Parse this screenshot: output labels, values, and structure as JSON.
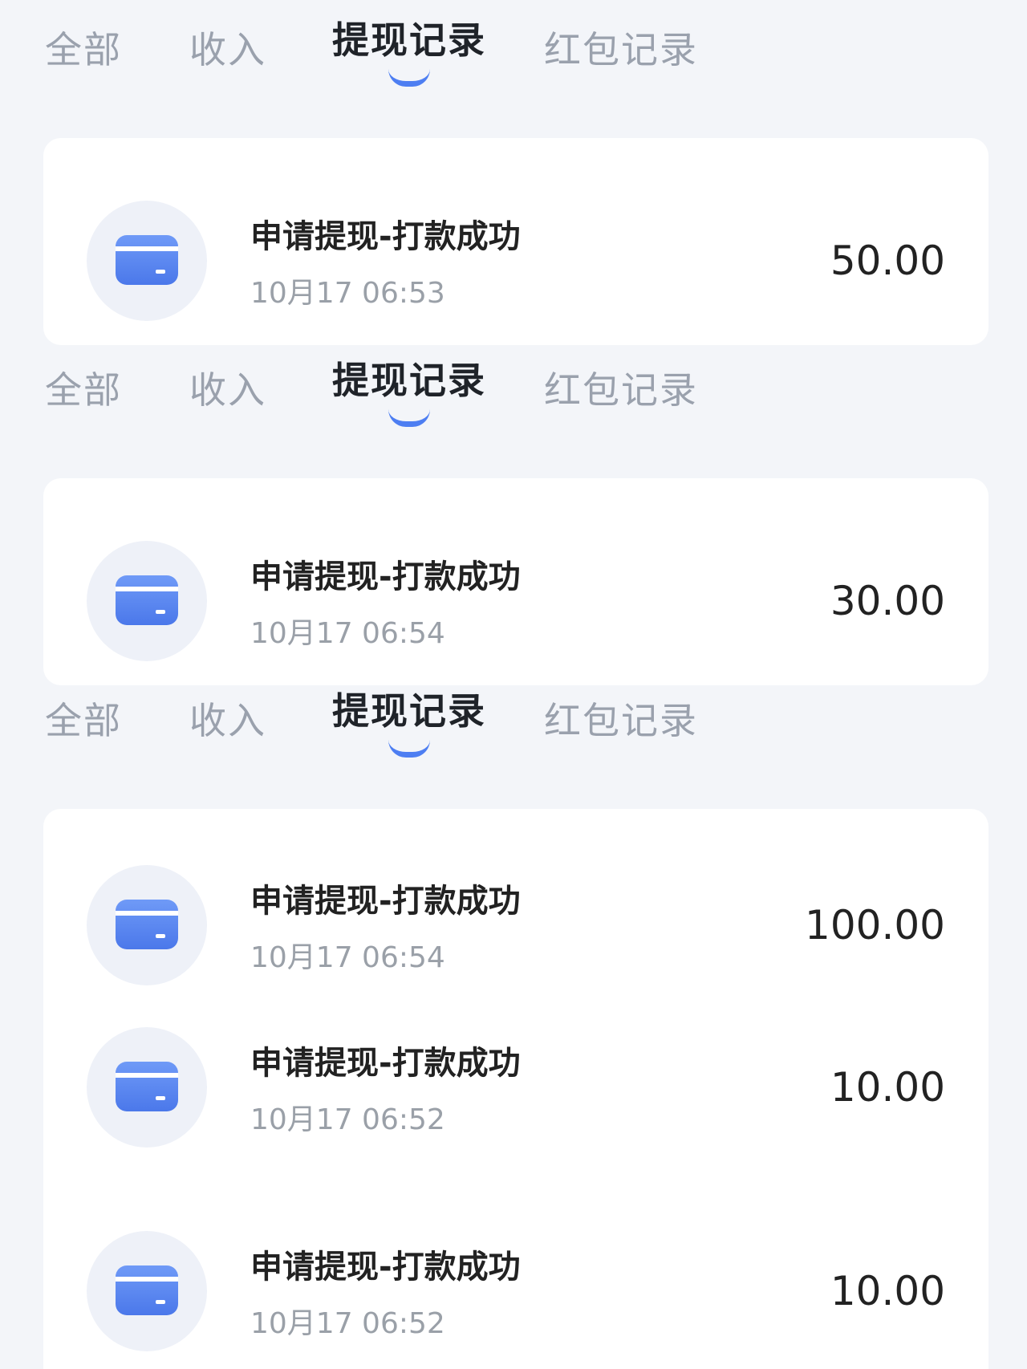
{
  "tabs": [
    "全部",
    "收入",
    "提现记录",
    "红包记录"
  ],
  "active_tab": "提现记录",
  "records": [
    {
      "title": "申请提现-打款成功",
      "time": "10月17 06:53",
      "amount": "50.00"
    },
    {
      "title": "申请提现-打款成功",
      "time": "10月17 06:54",
      "amount": "30.00"
    },
    {
      "title": "申请提现-打款成功",
      "time": "10月17 06:54",
      "amount": "100.00"
    },
    {
      "title": "申请提现-打款成功",
      "time": "10月17 06:52",
      "amount": "10.00"
    },
    {
      "title": "申请提现-打款成功",
      "time": "10月17 06:52",
      "amount": "10.00"
    }
  ],
  "colors": {
    "accent": "#4d7ef2",
    "background": "#f3f5f9",
    "card": "#ffffff"
  },
  "icons": {
    "record_icon": "bank-card-icon"
  }
}
